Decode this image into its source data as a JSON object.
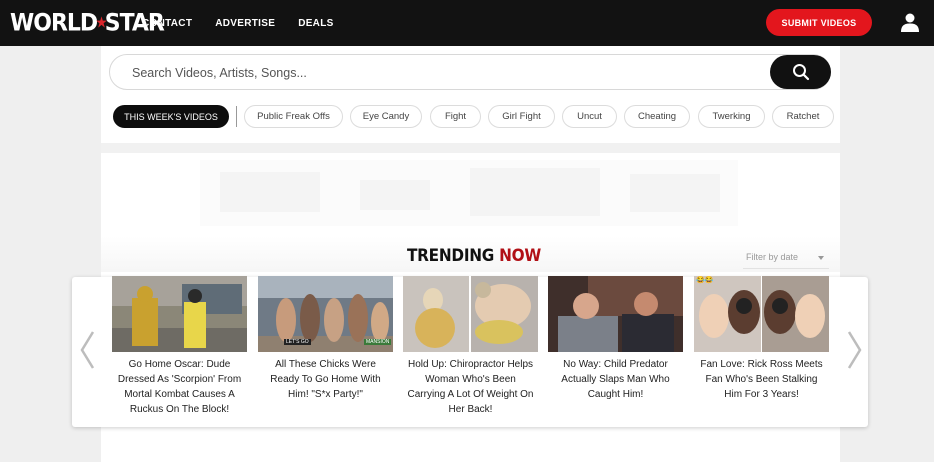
{
  "header": {
    "logo_text": "WORLDSTAR",
    "nav": [
      "CONTACT",
      "ADVERTISE",
      "DEALS"
    ],
    "submit_label": "SUBMIT VIDEOS",
    "brand_color": "#e3161d"
  },
  "search": {
    "placeholder": "Search Videos, Artists, Songs..."
  },
  "categories": {
    "active": "THIS WEEK'S VIDEOS",
    "items": [
      "Public Freak Offs",
      "Eye Candy",
      "Fight",
      "Girl Fight",
      "Uncut",
      "Cheating",
      "Twerking",
      "Ratchet"
    ]
  },
  "trending": {
    "title_a": "TRENDING",
    "title_b": "NOW",
    "filter_label": "Filter by date",
    "accent": "#b11016",
    "cards": [
      {
        "caption": "Go Home Oscar: Dude Dressed As 'Scorpion' From Mortal Kombat Causes A Ruckus On The Block!"
      },
      {
        "caption": "All These Chicks Were Ready To Go Home With Him! \"S*x Party!\"",
        "thumb_text_1": "LET'S GO",
        "thumb_text_2": "MANSION"
      },
      {
        "caption": "Hold Up: Chiropractor Helps Woman Who's Been Carrying A Lot Of Weight On Her Back!"
      },
      {
        "caption": "No Way: Child Predator Actually Slaps Man Who Caught Him!"
      },
      {
        "caption": "Fan Love: Rick Ross Meets Fan Who's Been Stalking Him For 3 Years!",
        "thumb_text_1": "😂😂"
      }
    ]
  }
}
